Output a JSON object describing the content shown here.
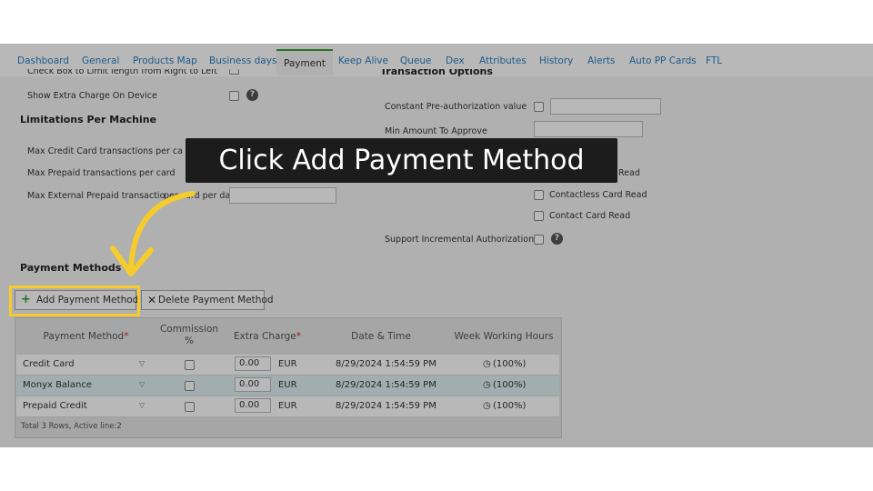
{
  "tabs": [
    {
      "label": "Dashboard"
    },
    {
      "label": "General"
    },
    {
      "label": "Products Map"
    },
    {
      "label": "Business days"
    },
    {
      "label": "Payment"
    },
    {
      "label": "Keep Alive"
    },
    {
      "label": "Queue"
    },
    {
      "label": "Dex"
    },
    {
      "label": "Attributes"
    },
    {
      "label": "History"
    },
    {
      "label": "Alerts"
    },
    {
      "label": "Auto PP Cards"
    },
    {
      "label": "FTL"
    }
  ],
  "active_tab": "Payment",
  "left": {
    "truncated_label": "Check Box to Limit length from Right to Left",
    "show_extra_charge": "Show Extra Charge On Device",
    "limitations_header": "Limitations Per Machine",
    "max_credit": "Max Credit Card transactions per ca",
    "max_prepaid": "Max Prepaid transactions per card",
    "max_external_a": "Max External Prepaid transactio",
    "max_external_b": "per card per day"
  },
  "right": {
    "header": "Transaction Options",
    "constant_preauth": "Constant Pre-authorization value",
    "min_amount": "Min Amount To Approve",
    "card_read_partial": "Read",
    "contactless": "Contactless Card Read",
    "contact": "Contact Card Read",
    "incremental": "Support Incremental Authorization"
  },
  "payment_methods": {
    "header": "Payment Methods",
    "add_label": "Add Payment Method",
    "delete_label": "Delete Payment Method",
    "columns": {
      "method": "Payment Method",
      "commission_a": "Commission",
      "commission_b": "%",
      "extra": "Extra Charge",
      "datetime": "Date & Time",
      "week": "Week Working Hours"
    },
    "required_mark": "*",
    "rows": [
      {
        "method": "Credit Card",
        "amount": "0.00",
        "currency": "EUR",
        "datetime": "8/29/2024 1:54:59 PM",
        "week": "(100%)"
      },
      {
        "method": "Monyx Balance",
        "amount": "0.00",
        "currency": "EUR",
        "datetime": "8/29/2024 1:54:59 PM",
        "week": "(100%)"
      },
      {
        "method": "Prepaid Credit",
        "amount": "0.00",
        "currency": "EUR",
        "datetime": "8/29/2024 1:54:59 PM",
        "week": "(100%)"
      }
    ],
    "footer": "Total 3 Rows, Active line:2"
  },
  "callout": "Click Add Payment Method",
  "colors": {
    "accent": "#f5cc2b",
    "tab_active": "#3aa03a",
    "link": "#2a7fc4",
    "add_icon": "#2e9d3a"
  }
}
